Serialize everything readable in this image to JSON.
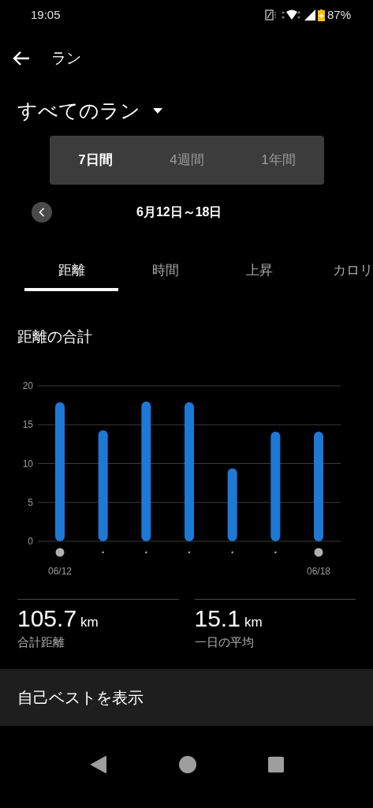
{
  "status_bar": {
    "time": "19:05",
    "battery": "87%"
  },
  "toolbar": {
    "title": "ラン"
  },
  "filter": {
    "label": "すべてのラン"
  },
  "periods": [
    {
      "label": "7日間",
      "selected": true
    },
    {
      "label": "4週間",
      "selected": false
    },
    {
      "label": "1年間",
      "selected": false
    }
  ],
  "date_range": "6月12日～18日",
  "tabs": [
    {
      "label": "距離",
      "selected": true
    },
    {
      "label": "時間",
      "selected": false
    },
    {
      "label": "上昇",
      "selected": false
    },
    {
      "label": "カロリ",
      "selected": false
    }
  ],
  "chart_title": "距離の合計",
  "chart_data": {
    "type": "bar",
    "categories": [
      "06/12",
      null,
      null,
      null,
      null,
      null,
      "06/18"
    ],
    "ylim": [
      0,
      20
    ],
    "grid": true,
    "yticks": [
      0,
      5,
      10,
      15,
      20
    ],
    "series": [
      {
        "color": "#1e78d6",
        "values": [
          17.9,
          14.3,
          18.0,
          17.9,
          9.4,
          14.1,
          14.1
        ]
      }
    ]
  },
  "stats": [
    {
      "value": "105.7",
      "unit": "km",
      "label": "合計距離"
    },
    {
      "value": "15.1",
      "unit": "km",
      "label": "一日の平均"
    }
  ],
  "best_button": "自己ベストを表示"
}
